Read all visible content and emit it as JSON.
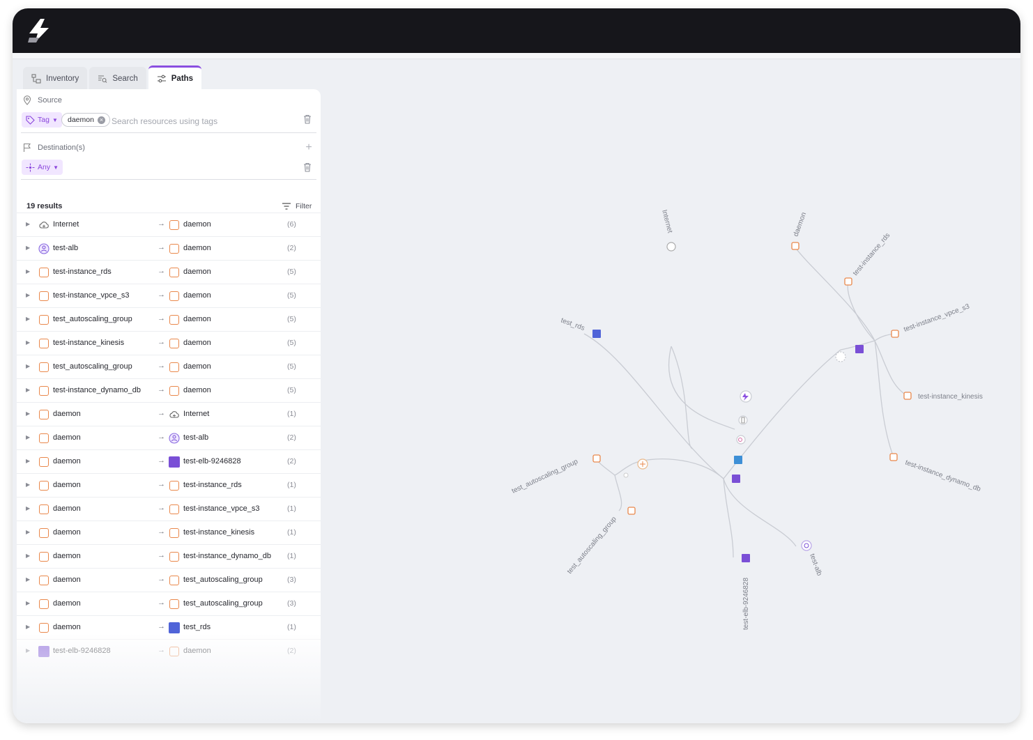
{
  "tabs": [
    {
      "label": "Inventory",
      "icon": "inventory-icon",
      "active": false
    },
    {
      "label": "Search",
      "icon": "search-icon",
      "active": false
    },
    {
      "label": "Paths",
      "icon": "paths-icon",
      "active": true
    }
  ],
  "source": {
    "label": "Source",
    "filter_chip": "Tag",
    "tag_pill": "daemon",
    "search_placeholder": "Search resources using tags"
  },
  "destination": {
    "label": "Destination(s)",
    "filter_chip": "Any"
  },
  "results": {
    "count_label": "19 results",
    "filter_label": "Filter",
    "rows": [
      {
        "source": "Internet",
        "source_icon": "cloud-icon",
        "destination": "daemon",
        "destination_icon": "instance-icon",
        "count": "(6)"
      },
      {
        "source": "test-alb",
        "source_icon": "load-balancer-icon",
        "destination": "daemon",
        "destination_icon": "instance-icon",
        "count": "(2)"
      },
      {
        "source": "test-instance_rds",
        "source_icon": "instance-icon",
        "destination": "daemon",
        "destination_icon": "instance-icon",
        "count": "(5)"
      },
      {
        "source": "test-instance_vpce_s3",
        "source_icon": "instance-icon",
        "destination": "daemon",
        "destination_icon": "instance-icon",
        "count": "(5)"
      },
      {
        "source": "test_autoscaling_group",
        "source_icon": "instance-icon",
        "destination": "daemon",
        "destination_icon": "instance-icon",
        "count": "(5)"
      },
      {
        "source": "test-instance_kinesis",
        "source_icon": "instance-icon",
        "destination": "daemon",
        "destination_icon": "instance-icon",
        "count": "(5)"
      },
      {
        "source": "test_autoscaling_group",
        "source_icon": "instance-icon",
        "destination": "daemon",
        "destination_icon": "instance-icon",
        "count": "(5)"
      },
      {
        "source": "test-instance_dynamo_db",
        "source_icon": "instance-icon",
        "destination": "daemon",
        "destination_icon": "instance-icon",
        "count": "(5)"
      },
      {
        "source": "daemon",
        "source_icon": "instance-icon",
        "destination": "Internet",
        "destination_icon": "cloud-icon",
        "count": "(1)"
      },
      {
        "source": "daemon",
        "source_icon": "instance-icon",
        "destination": "test-alb",
        "destination_icon": "load-balancer-icon",
        "count": "(2)"
      },
      {
        "source": "daemon",
        "source_icon": "instance-icon",
        "destination": "test-elb-9246828",
        "destination_icon": "elb-icon",
        "count": "(2)"
      },
      {
        "source": "daemon",
        "source_icon": "instance-icon",
        "destination": "test-instance_rds",
        "destination_icon": "instance-icon",
        "count": "(1)"
      },
      {
        "source": "daemon",
        "source_icon": "instance-icon",
        "destination": "test-instance_vpce_s3",
        "destination_icon": "instance-icon",
        "count": "(1)"
      },
      {
        "source": "daemon",
        "source_icon": "instance-icon",
        "destination": "test-instance_kinesis",
        "destination_icon": "instance-icon",
        "count": "(1)"
      },
      {
        "source": "daemon",
        "source_icon": "instance-icon",
        "destination": "test-instance_dynamo_db",
        "destination_icon": "instance-icon",
        "count": "(1)"
      },
      {
        "source": "daemon",
        "source_icon": "instance-icon",
        "destination": "test_autoscaling_group",
        "destination_icon": "instance-icon",
        "count": "(3)"
      },
      {
        "source": "daemon",
        "source_icon": "instance-icon",
        "destination": "test_autoscaling_group",
        "destination_icon": "instance-icon",
        "count": "(3)"
      },
      {
        "source": "daemon",
        "source_icon": "instance-icon",
        "destination": "test_rds",
        "destination_icon": "rds-icon",
        "count": "(1)"
      },
      {
        "source": "test-elb-9246828",
        "source_icon": "elb-icon",
        "destination": "daemon",
        "destination_icon": "instance-icon",
        "count": "(2)"
      }
    ]
  },
  "graph": {
    "labels": {
      "internet": "Internet",
      "daemon": "daemon",
      "test_instance_rds": "test-instance_rds",
      "test_instance_vpce_s3": "test-instance_vpce_s3",
      "test_instance_kinesis": "test-instance_kinesis",
      "test_instance_dynamo_db": "test-instance_dynamo_db",
      "test_rds": "test_rds",
      "test_autoscaling_group_a": "test_autoscaling_group",
      "test_autoscaling_group_b": "test_autoscaling_group",
      "test_elb": "test-elb-9246828",
      "test_alb": "test-alb"
    },
    "colors": {
      "edge": "#c9ccd3",
      "instance": "#e9874a",
      "elb": "#7a4fd6",
      "rds": "#5064d8",
      "accent": "#8b4fe0"
    }
  }
}
